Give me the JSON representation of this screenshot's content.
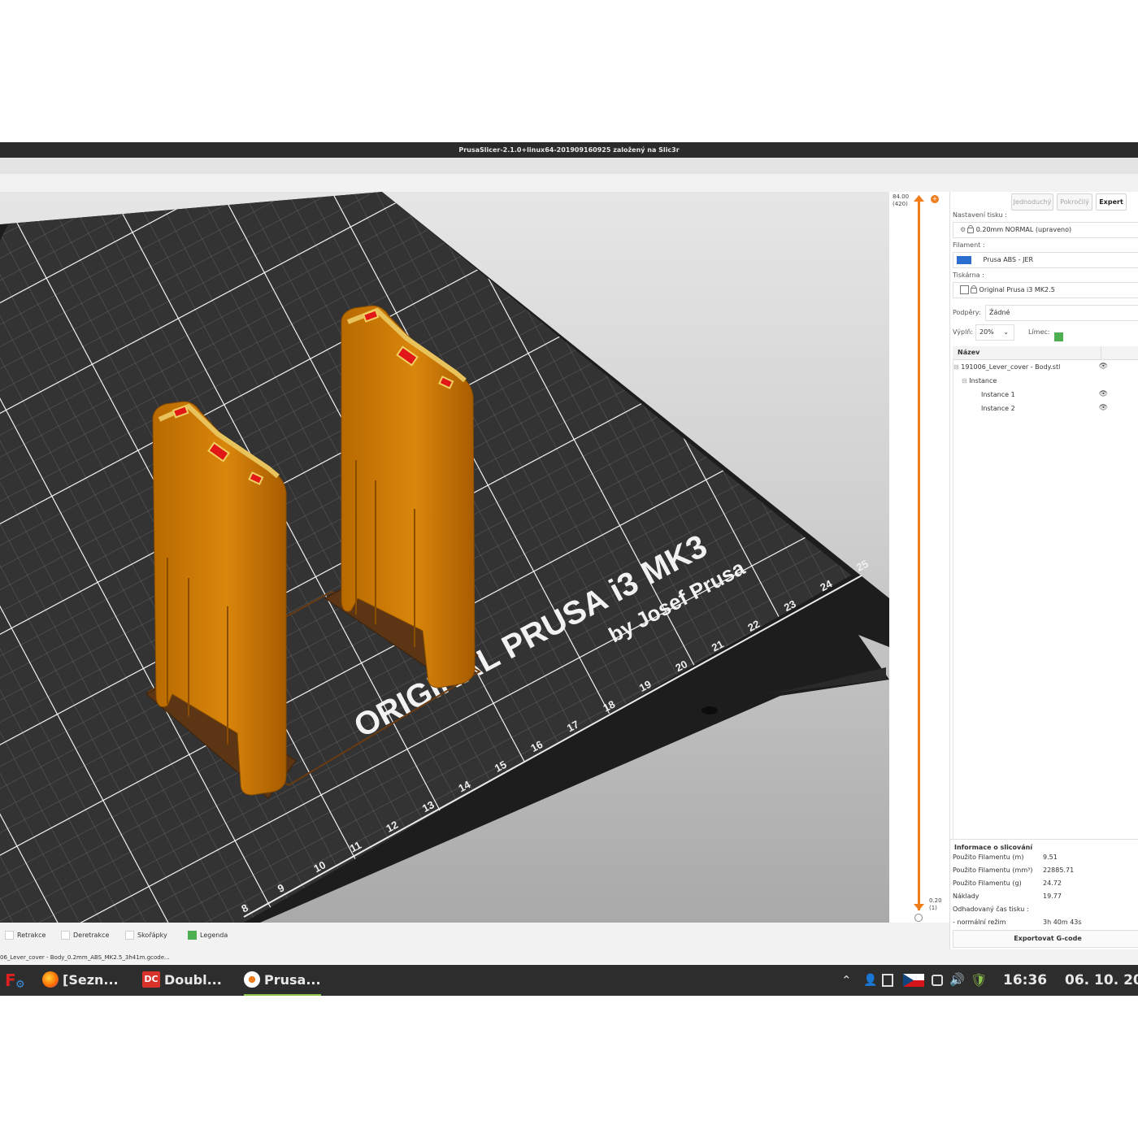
{
  "window": {
    "title": "PrusaSlicer-2.1.0+linux64-201909160925 založený na Slic3r"
  },
  "viewport": {
    "bed_text_line1": "ORIGINAL PRUSA i3 MK3",
    "bed_text_line2": "by Josef Prusa",
    "ruler_numbers": [
      "8",
      "9",
      "10",
      "11",
      "12",
      "13",
      "14",
      "15",
      "16",
      "17",
      "18",
      "19",
      "20",
      "21",
      "22",
      "23",
      "24",
      "25"
    ]
  },
  "layer_slider": {
    "top_value": "84.00",
    "top_layer": "(420)",
    "bottom_value": "0.20",
    "bottom_layer": "(1)",
    "accent_color": "#f07c1a"
  },
  "sidebar": {
    "modes": [
      "Jednoduchý",
      "Pokročilý",
      "Expert"
    ],
    "active_mode": "Expert",
    "print_settings_label": "Nastavení tisku :",
    "print_settings_value": "0.20mm NORMAL (upraveno)",
    "filament_label": "Filament :",
    "filament_value": "Prusa ABS - JER",
    "filament_color": "#2a6fcf",
    "printer_label": "Tiskárna :",
    "printer_value": "Original Prusa i3 MK2.5",
    "supports_label": "Podpěry:",
    "supports_value": "Žádné",
    "infill_label": "Výplň:",
    "infill_value": "20%",
    "brim_label": "Límec:",
    "brim_checked": true,
    "object_list_header": "Název",
    "objects": [
      {
        "name": "191006_Lever_cover - Body.stl",
        "indent": 0,
        "eye": true
      },
      {
        "name": "Instance",
        "indent": 1,
        "eye": false
      },
      {
        "name": "Instance 1",
        "indent": 2,
        "eye": true
      },
      {
        "name": "Instance 2",
        "indent": 2,
        "eye": true
      }
    ],
    "slice_info": {
      "title": "Informace o slicování",
      "rows": [
        {
          "label": "Použito Filamentu (m)",
          "value": "9.51"
        },
        {
          "label": "Použito Filamentu (mm³)",
          "value": "22885.71"
        },
        {
          "label": "Použito Filamentu (g)",
          "value": "24.72"
        },
        {
          "label": "Náklady",
          "value": "19.77"
        },
        {
          "label": "Odhadovaný čas tisku :",
          "value": ""
        },
        {
          "label": "- normální režim",
          "value": "3h 40m 43s"
        }
      ]
    },
    "export_button": "Exportovat G-code"
  },
  "legend_bar": {
    "items": [
      {
        "label": "Retrakce",
        "checked": false
      },
      {
        "label": "Deretrakce",
        "checked": false
      },
      {
        "label": "Skořápky",
        "checked": false
      },
      {
        "label": "Legenda",
        "checked": true
      }
    ]
  },
  "status_bar": {
    "text": "06_Lever_cover - Body_0.2mm_ABS_MK2.5_3h41m.gcode..."
  },
  "taskbar": {
    "tasks": [
      "[Sezn...",
      "Doubl...",
      "Prusa..."
    ],
    "clock": "16:36",
    "date": "06. 10. 20"
  }
}
